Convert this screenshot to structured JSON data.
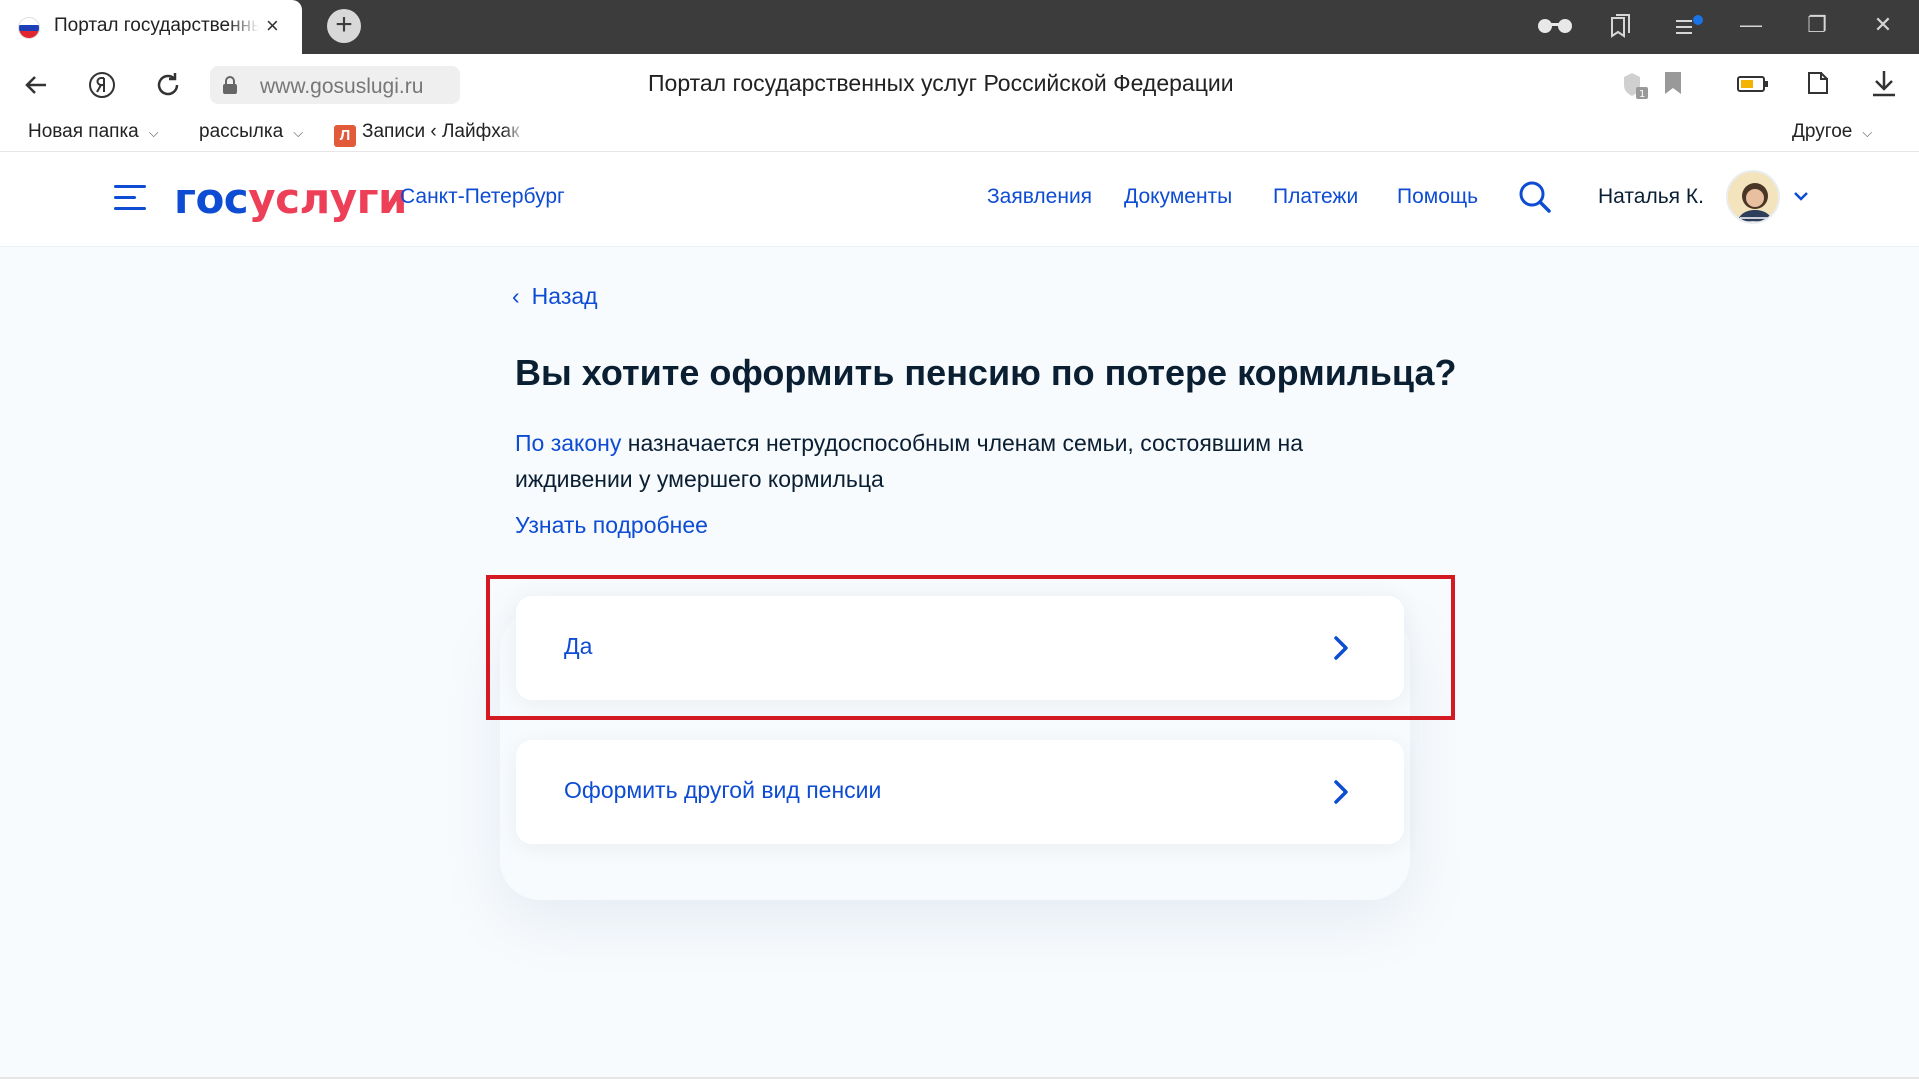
{
  "browser": {
    "tab_title": "Портал государственных услуг",
    "tab_close": "×",
    "new_tab": "+",
    "url": "www.gosuslugi.ru",
    "page_title": "Портал государственных услуг Российской Федерации",
    "window_buttons": [
      "—",
      "❐",
      "✕"
    ],
    "bookmarks": [
      {
        "label": "Новая папка",
        "chevron": "⌵"
      },
      {
        "label": "рассылка",
        "chevron": "⌵"
      },
      {
        "label": "Записи ‹ Лайфхак",
        "favicon": "Л"
      }
    ],
    "other_bookmarks": "Другое",
    "other_chevron": "⌵"
  },
  "header": {
    "logo_part1": "гос",
    "logo_part2": "услуги",
    "region": "Санкт-Петербург",
    "nav": [
      "Заявления",
      "Документы",
      "Платежи",
      "Помощь"
    ],
    "user_name": "Наталья К."
  },
  "content": {
    "back_arrow": "‹",
    "back_label": "Назад",
    "title": "Вы хотите оформить пенсию по потере кормильца?",
    "desc_link": "По закону",
    "desc_text": " назначается нетрудоспособным членам семьи, состоявшим на иждивении у умершего кормильца",
    "more_link": "Узнать подробнее",
    "choices": [
      {
        "label": "Да"
      },
      {
        "label": "Оформить другой вид пенсии"
      }
    ]
  },
  "colors": {
    "brand_blue": "#0d4cd3",
    "brand_red": "#ee3f58",
    "highlight_red": "#d31a22"
  }
}
